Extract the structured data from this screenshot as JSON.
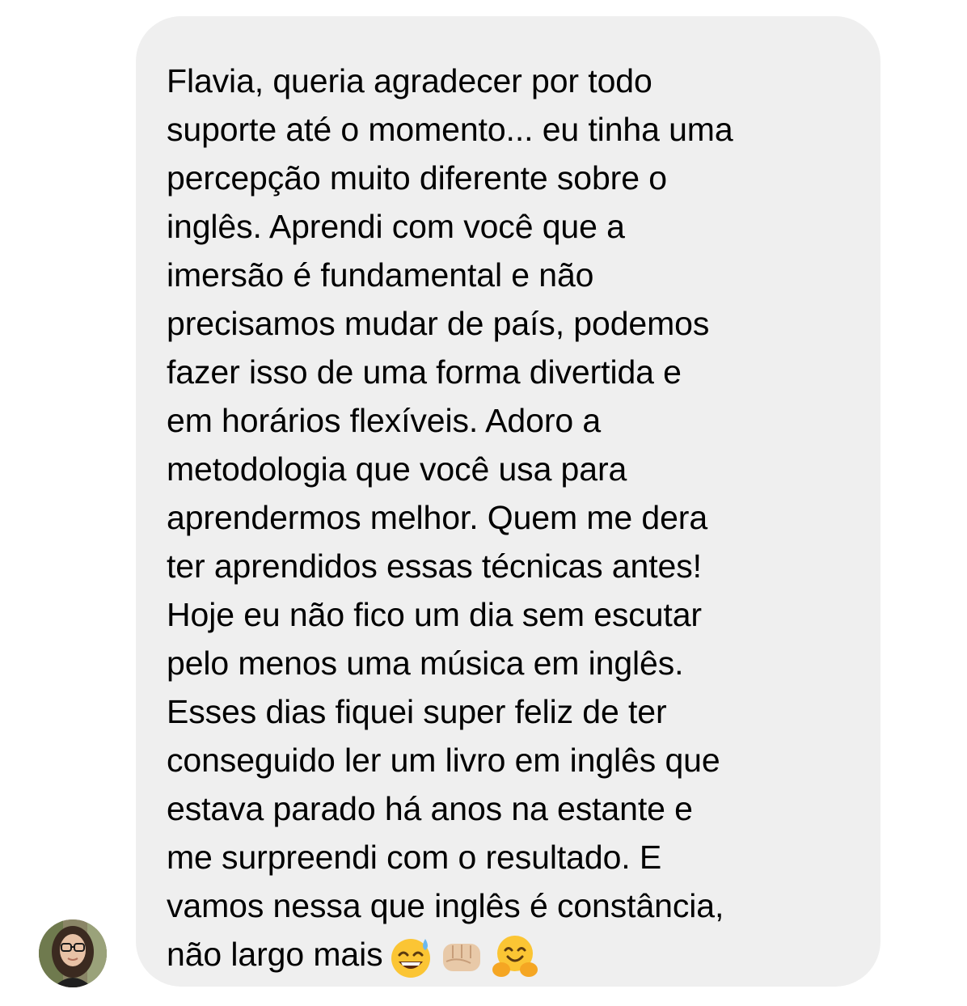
{
  "conversation": {
    "message": {
      "lines": [
        "Flavia, queria agradecer por todo",
        "suporte até o momento... eu tinha uma",
        "percepção muito diferente sobre o",
        "inglês. Aprendi com você que a",
        "imersão é fundamental e não",
        "precisamos mudar de país, podemos",
        "fazer isso de uma forma divertida e",
        "em horários flexíveis. Adoro a",
        "metodologia que você usa para",
        "aprendermos melhor. Quem me dera",
        "ter aprendidos essas técnicas antes!",
        "Hoje eu não fico um dia sem escutar",
        "pelo menos uma música em inglês.",
        "Esses dias fiquei super feliz de ter",
        "conseguido ler um livro em inglês que",
        "estava parado há anos na estante e",
        "me surpreendi com o resultado. E",
        "vamos nessa que inglês é constância,",
        "não largo mais"
      ],
      "emojis": [
        "grinning-sweat-emoji",
        "fist-bump-emoji",
        "hugging-face-emoji"
      ]
    },
    "sender_avatar": "avatar-photo"
  },
  "colors": {
    "bubble_background": "#efefef",
    "text": "#000000",
    "page_background": "#ffffff"
  }
}
